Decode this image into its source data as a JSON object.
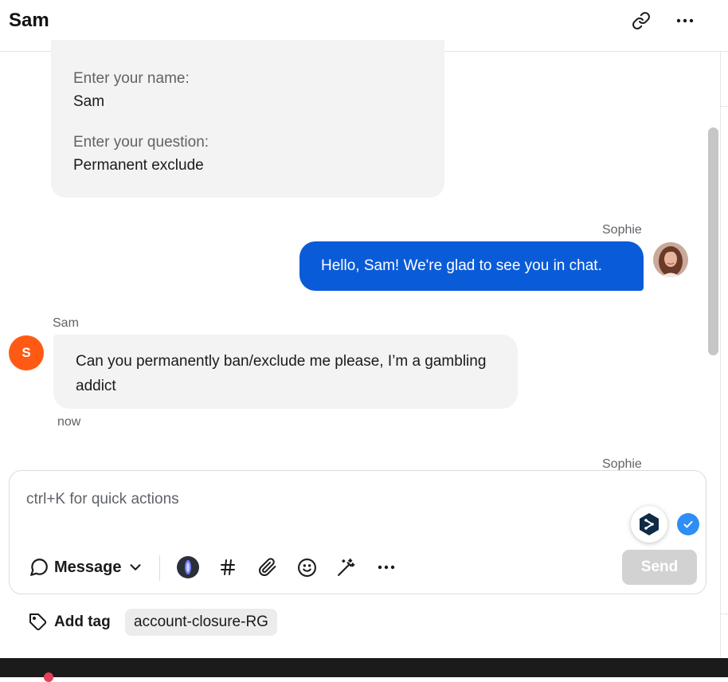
{
  "header": {
    "title": "Sam",
    "link_icon": "link-icon",
    "more_icon": "more-horizontal-icon"
  },
  "form": {
    "name_label": "Enter your name:",
    "name_value": "Sam",
    "question_label": "Enter your question:",
    "question_value": "Permanent exclude"
  },
  "messages": {
    "agent_name": "Sophie",
    "agent_text": "Hello, Sam! We're glad to see you in chat.",
    "user_name": "Sam",
    "user_initial": "S",
    "user_text": "Can you permanently ban/exclude me please, I’m a gambling addict",
    "user_time": "now",
    "agent_name_next": "Sophie"
  },
  "composer": {
    "placeholder": "ctrl+K for quick actions",
    "mode_label": "Message",
    "send_label": "Send",
    "tools": [
      "ai-assist-icon",
      "hashtag-icon",
      "paperclip-icon",
      "emoji-icon",
      "magic-wand-icon",
      "more-horizontal-icon"
    ]
  },
  "tags": {
    "add_tag_label": "Add tag",
    "items": [
      "account-closure-RG"
    ]
  },
  "colors": {
    "agent_bubble": "#0a5bd8",
    "user_avatar": "#ff5a14",
    "send_disabled": "#d2d2d2",
    "check_badge": "#2f8ef5"
  }
}
